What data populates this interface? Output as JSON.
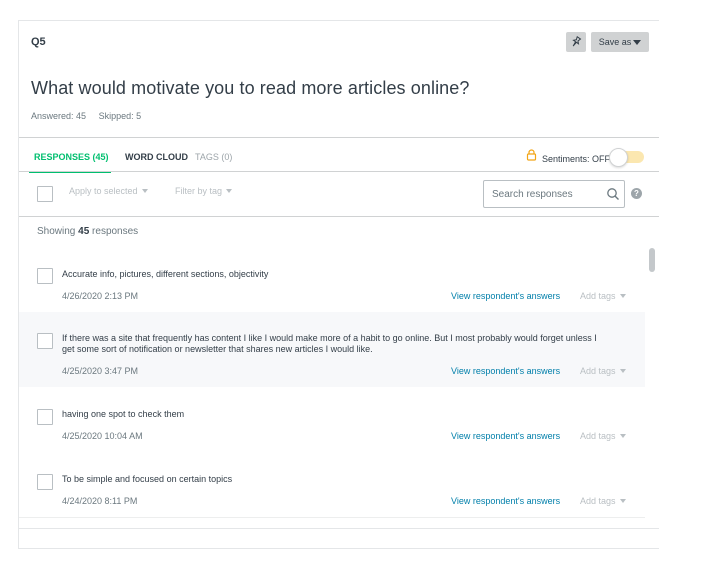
{
  "question": {
    "id": "Q5",
    "text": "What would motivate you to read more articles online?",
    "answered": "Answered: 45",
    "skipped": "Skipped: 5"
  },
  "header_buttons": {
    "pin_icon": "pin-icon",
    "save_label": "Save as"
  },
  "tabs": [
    {
      "label": "RESPONSES (45)",
      "active": true
    },
    {
      "label": "WORD CLOUD",
      "active": false
    },
    {
      "label": "TAGS (0)",
      "active": false
    }
  ],
  "sentiments": {
    "label": "Sentiments: OFF",
    "enabled": false
  },
  "toolbar": {
    "apply_label": "Apply to selected",
    "filter_label": "Filter by tag",
    "search_placeholder": "Search responses",
    "help_glyph": "?"
  },
  "showing": {
    "prefix": "Showing",
    "count": "45",
    "suffix": "responses"
  },
  "responses": [
    {
      "text": "Accurate info, pictures, different sections, objectivity",
      "date": "4/26/2020 2:13 PM",
      "view": "View respondent's answers",
      "tags": "Add tags"
    },
    {
      "text": "If there was a site that frequently has content I like I would make more of a habit to go online. But I most probably would forget unless I get some sort of notification or newsletter that shares new articles I would like.",
      "date": "4/25/2020 3:47 PM",
      "view": "View respondent's answers",
      "tags": "Add tags"
    },
    {
      "text": "having one spot to check them",
      "date": "4/25/2020 10:04 AM",
      "view": "View respondent's answers",
      "tags": "Add tags"
    },
    {
      "text": "To be simple and focused on certain topics",
      "date": "4/24/2020 8:11 PM",
      "view": "View respondent's answers",
      "tags": "Add tags"
    }
  ],
  "colors": {
    "accent_green": "#00bf6f",
    "link_blue": "#007faa",
    "toggle_track": "#fbe7b0"
  }
}
